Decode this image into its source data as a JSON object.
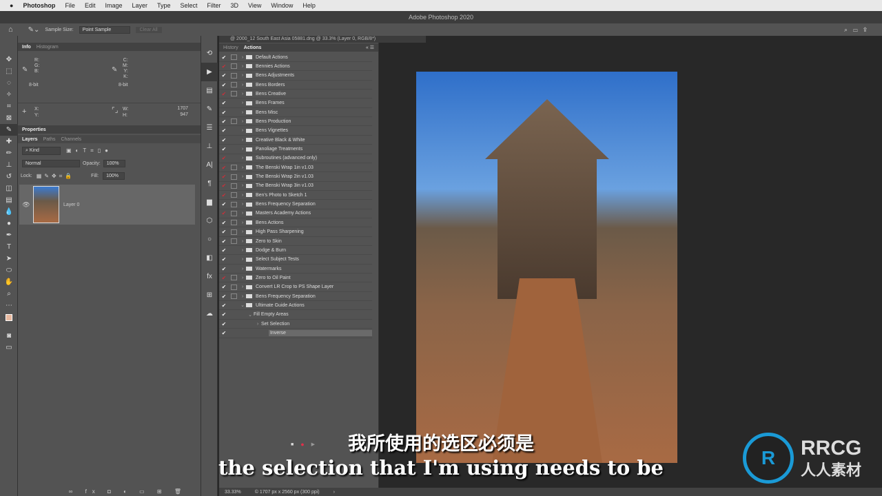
{
  "menubar": {
    "app": "Photoshop",
    "items": [
      "File",
      "Edit",
      "Image",
      "Layer",
      "Type",
      "Select",
      "Filter",
      "3D",
      "View",
      "Window",
      "Help"
    ]
  },
  "window_title": "Adobe Photoshop 2020",
  "options": {
    "sample_size_label": "Sample Size:",
    "sample_size_value": "Point Sample",
    "clear_all": "Clear All"
  },
  "info": {
    "tabs": [
      "Info",
      "Histogram"
    ],
    "rgb": "R:\nG:\nB:",
    "cmyk": "C:\nM:\nY:\nK:",
    "bit1": "8-bit",
    "bit2": "8-bit",
    "xy": "X:\nY:",
    "wh": "W:\nH:",
    "w": "1707",
    "h": "947"
  },
  "properties": {
    "title": "Properties"
  },
  "layers": {
    "tabs": [
      "Layers",
      "Paths",
      "Channels"
    ],
    "kind": "Kind",
    "blend": "Normal",
    "opacity_label": "Opacity:",
    "opacity": "100%",
    "lock_label": "Lock:",
    "fill_label": "Fill:",
    "fill": "100%",
    "layer_name": "Layer 0"
  },
  "doc_tab": "@ 2000_12 South East Asia 05881.dng @ 33.3% (Layer 0, RGB/8*)",
  "actions_panel": {
    "tabs": [
      "History",
      "Actions"
    ],
    "items": [
      {
        "name": "Default Actions",
        "check": "white",
        "dialog": true,
        "level": 0,
        "expanded": false
      },
      {
        "name": "Bennies Actions",
        "check": "red",
        "dialog": true,
        "level": 0,
        "expanded": false
      },
      {
        "name": "Bens Adjustments",
        "check": "white",
        "dialog": true,
        "level": 0,
        "expanded": false
      },
      {
        "name": "Bens Borders",
        "check": "white",
        "dialog": true,
        "level": 0,
        "expanded": false
      },
      {
        "name": "Bens Creative",
        "check": "red",
        "dialog": true,
        "level": 0,
        "expanded": false
      },
      {
        "name": "Bens Frames",
        "check": "white",
        "dialog": false,
        "level": 0,
        "expanded": false
      },
      {
        "name": "Bens Misc",
        "check": "white",
        "dialog": false,
        "level": 0,
        "expanded": false
      },
      {
        "name": "Bens Production",
        "check": "white",
        "dialog": true,
        "level": 0,
        "expanded": false
      },
      {
        "name": "Bens Vignettes",
        "check": "white",
        "dialog": false,
        "level": 0,
        "expanded": false
      },
      {
        "name": "Creative Black & White",
        "check": "white",
        "dialog": false,
        "level": 0,
        "expanded": false
      },
      {
        "name": "Panoliage Treatments",
        "check": "white",
        "dialog": false,
        "level": 0,
        "expanded": false
      },
      {
        "name": "Subroutines (advanced only)",
        "check": "red",
        "dialog": false,
        "level": 0,
        "expanded": false
      },
      {
        "name": "The Benski Wrap 1in v1.03",
        "check": "red",
        "dialog": true,
        "level": 0,
        "expanded": false
      },
      {
        "name": "The Benski Wrap 2in v1.03",
        "check": "red",
        "dialog": true,
        "level": 0,
        "expanded": false
      },
      {
        "name": "The Benski Wrap 3in v1.03",
        "check": "red",
        "dialog": true,
        "level": 0,
        "expanded": false
      },
      {
        "name": "Ben's Photo to Sketch 1",
        "check": "red",
        "dialog": true,
        "level": 0,
        "expanded": false
      },
      {
        "name": "Bens Frequency Separation",
        "check": "white",
        "dialog": true,
        "level": 0,
        "expanded": false
      },
      {
        "name": "Masters Academy Actions",
        "check": "red",
        "dialog": true,
        "level": 0,
        "expanded": false
      },
      {
        "name": "Bens Actions",
        "check": "white",
        "dialog": true,
        "level": 0,
        "expanded": false
      },
      {
        "name": "High Pass Sharpening",
        "check": "white",
        "dialog": true,
        "level": 0,
        "expanded": false
      },
      {
        "name": "Zero to Skin",
        "check": "white",
        "dialog": true,
        "level": 0,
        "expanded": false
      },
      {
        "name": "Dodge & Burn",
        "check": "white",
        "dialog": false,
        "level": 0,
        "expanded": false
      },
      {
        "name": "Select Subject Tests",
        "check": "white",
        "dialog": false,
        "level": 0,
        "expanded": false
      },
      {
        "name": "Watermarks",
        "check": "white",
        "dialog": false,
        "level": 0,
        "expanded": false
      },
      {
        "name": "Zero to Oil Paint",
        "check": "red",
        "dialog": true,
        "level": 0,
        "expanded": false
      },
      {
        "name": "Convert LR Crop to PS Shape Layer",
        "check": "white",
        "dialog": true,
        "level": 0,
        "expanded": false
      },
      {
        "name": "Bens Frequency Separation",
        "check": "white",
        "dialog": true,
        "level": 0,
        "expanded": false
      },
      {
        "name": "Ultimate Guide Actions",
        "check": "white",
        "dialog": false,
        "level": 0,
        "expanded": true
      },
      {
        "name": "Fill Empty Areas",
        "check": "white",
        "dialog": false,
        "level": 1,
        "expanded": true
      },
      {
        "name": "Set Selection",
        "check": "white",
        "dialog": false,
        "level": 2,
        "expanded": false
      },
      {
        "name": "Inverse",
        "check": "white",
        "dialog": false,
        "level": 3,
        "expanded": false,
        "selected": true
      }
    ]
  },
  "status": {
    "zoom": "33.33%",
    "doc_info": "© 1707 px x 2560 px (300 ppi)"
  },
  "subtitles": {
    "zh": "我所使用的选区必须是",
    "en": "the selection that I'm using needs to be"
  },
  "watermark": {
    "logo_text": "RRCG 人人素材"
  },
  "colors": {
    "record_red": "#e0304a",
    "check_red": "#c8303a",
    "logo_blue": "#1a9ad6"
  }
}
